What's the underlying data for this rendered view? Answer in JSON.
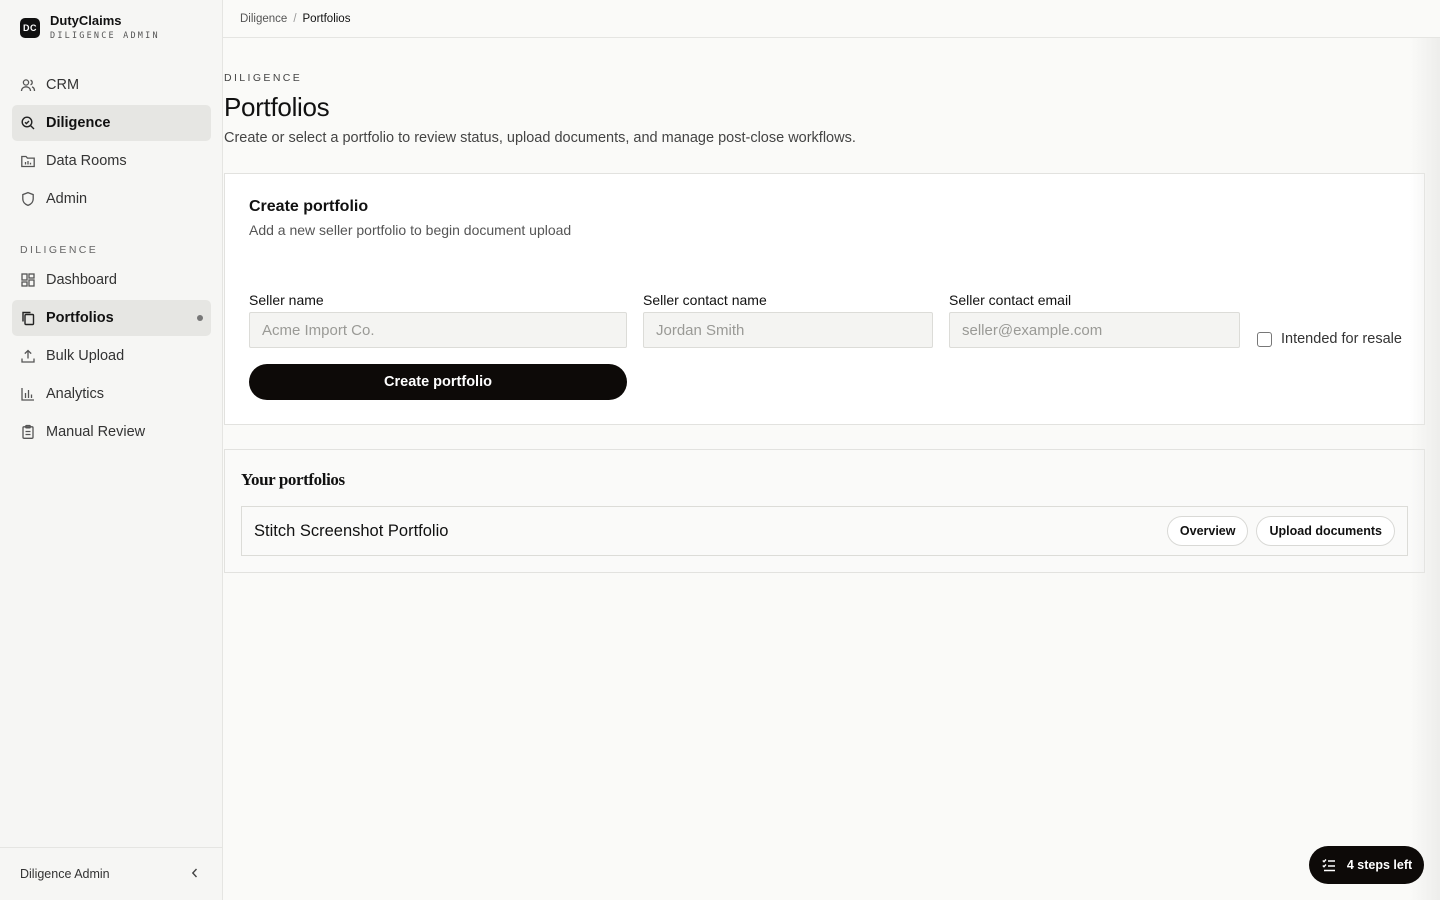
{
  "brand": {
    "mark": "DC",
    "name": "DutyClaims",
    "subtitle": "DILIGENCE ADMIN"
  },
  "sidebar": {
    "top_items": [
      {
        "label": "CRM",
        "icon": "users-icon",
        "active": false
      },
      {
        "label": "Diligence",
        "icon": "search-icon",
        "active": true
      },
      {
        "label": "Data Rooms",
        "icon": "folder-chart-icon",
        "active": false
      },
      {
        "label": "Admin",
        "icon": "shield-icon",
        "active": false
      }
    ],
    "section_label": "DILIGENCE",
    "section_items": [
      {
        "label": "Dashboard",
        "icon": "grid-icon",
        "active": false
      },
      {
        "label": "Portfolios",
        "icon": "copy-icon",
        "active": true
      },
      {
        "label": "Bulk Upload",
        "icon": "upload-icon",
        "active": false
      },
      {
        "label": "Analytics",
        "icon": "bar-chart-icon",
        "active": false
      },
      {
        "label": "Manual Review",
        "icon": "clipboard-icon",
        "active": false
      }
    ],
    "footer_label": "Diligence Admin"
  },
  "breadcrumb": {
    "parent": "Diligence",
    "separator": "/",
    "current": "Portfolios"
  },
  "header": {
    "eyebrow": "DILIGENCE",
    "title": "Portfolios",
    "description": "Create or select a portfolio to review status, upload documents, and manage post-close workflows."
  },
  "create_card": {
    "title": "Create portfolio",
    "subtitle": "Add a new seller portfolio to begin document upload",
    "fields": {
      "seller_name": {
        "label": "Seller name",
        "placeholder": "Acme Import Co.",
        "value": ""
      },
      "contact_name": {
        "label": "Seller contact name",
        "placeholder": "Jordan Smith",
        "value": ""
      },
      "contact_email": {
        "label": "Seller contact email",
        "placeholder": "seller@example.com",
        "value": ""
      }
    },
    "resale_label": "Intended for resale",
    "resale_checked": false,
    "submit_label": "Create portfolio"
  },
  "portfolios": {
    "title": "Your portfolios",
    "items": [
      {
        "name": "Stitch Screenshot Portfolio",
        "overview_label": "Overview",
        "upload_label": "Upload documents"
      }
    ]
  },
  "steps_pill": {
    "label": "4 steps left"
  }
}
